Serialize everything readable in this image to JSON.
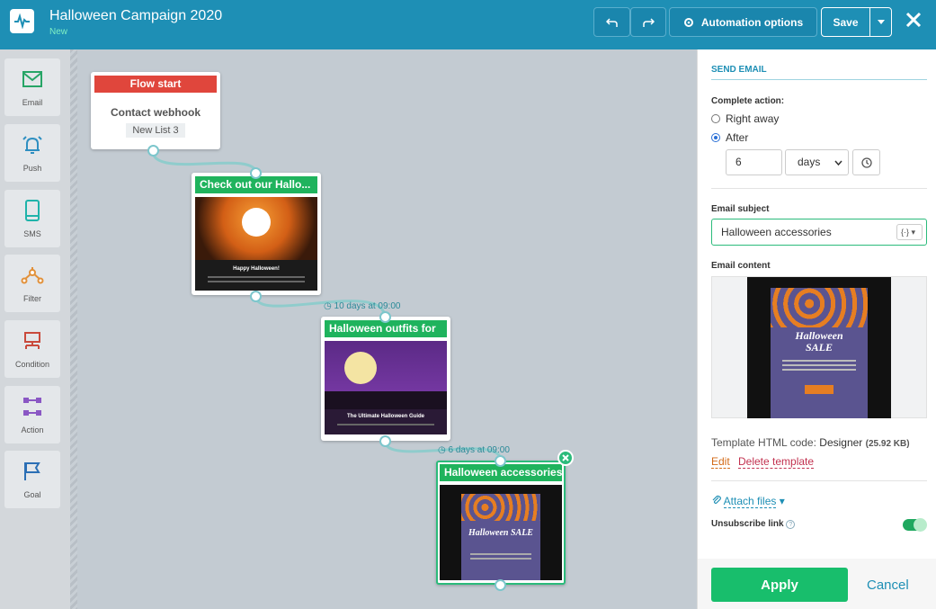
{
  "header": {
    "title": "Halloween Campaign 2020",
    "status": "New",
    "automation_options": "Automation options",
    "save": "Save"
  },
  "tools": [
    {
      "label": "Email",
      "icon": "email-icon"
    },
    {
      "label": "Push",
      "icon": "bell-icon"
    },
    {
      "label": "SMS",
      "icon": "phone-icon"
    },
    {
      "label": "Filter",
      "icon": "filter-icon"
    },
    {
      "label": "Condition",
      "icon": "condition-icon"
    },
    {
      "label": "Action",
      "icon": "action-icon"
    },
    {
      "label": "Goal",
      "icon": "flag-icon"
    }
  ],
  "flow": {
    "start": {
      "header": "Flow start",
      "title": "Contact webhook",
      "list": "New List 3"
    },
    "nodes": [
      {
        "header": "Check out our Hallo...",
        "preview_title": "Happy Halloween!"
      },
      {
        "header": "Halloween outfits for",
        "delay": "10 days at 09:00",
        "preview_title": "The Ultimate Halloween Guide"
      },
      {
        "header": "Halloween accessories",
        "delay": "6 days at 09:00",
        "preview_title": "Halloween SALE"
      }
    ]
  },
  "panel": {
    "section_title": "SEND EMAIL",
    "complete_action_label": "Complete action:",
    "options": [
      "Right away",
      "After"
    ],
    "selected_option": "After",
    "delay_value": "6",
    "delay_unit": "days",
    "subject_label": "Email subject",
    "subject_value": "Halloween accessories",
    "content_label": "Email content",
    "preview_heading": "Halloween",
    "preview_heading2": "SALE",
    "template_label": "Template HTML code:",
    "template_type": "Designer",
    "template_size": "(25.92 KB)",
    "edit": "Edit",
    "delete": "Delete template",
    "attach": "Attach files",
    "unsubscribe": "Unsubscribe link",
    "unsubscribe_enabled": true,
    "apply": "Apply",
    "cancel": "Cancel"
  },
  "colors": {
    "header_bg": "#1e8fb5",
    "start_red": "#e0463c",
    "node_green": "#1fb35d",
    "apply_green": "#18be6c"
  }
}
